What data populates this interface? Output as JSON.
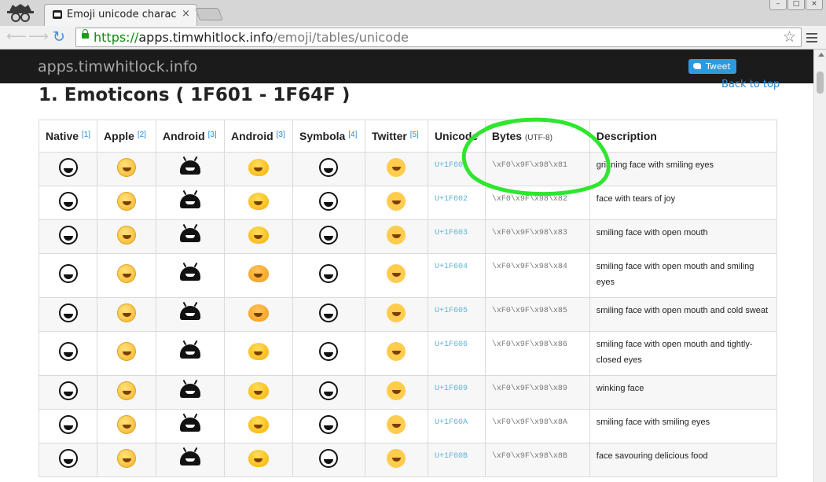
{
  "browser": {
    "tab_title": "Emoji unicode charac",
    "tab_close": "×",
    "url_scheme": "https://",
    "url_host": "apps.timwhitlock.info",
    "url_path": "/emoji/tables/unicode",
    "window_minimize": "–",
    "window_maximize": "□",
    "window_close": "×"
  },
  "site": {
    "brand": "apps.timwhitlock.info",
    "tweet_label": "Tweet",
    "back_to_top": "Back to top",
    "heading": "1. Emoticons ( 1F601 - 1F64F )"
  },
  "table": {
    "headers": [
      {
        "label": "Native",
        "note": "[1]"
      },
      {
        "label": "Apple",
        "note": "[2]"
      },
      {
        "label": "Android",
        "note": "[3]"
      },
      {
        "label": "Android",
        "note": "[3]"
      },
      {
        "label": "Symbola",
        "note": "[4]"
      },
      {
        "label": "Twitter",
        "note": "[5]"
      },
      {
        "label": "Unicode",
        "note": ""
      },
      {
        "label": "Bytes",
        "note": "(UTF-8)"
      },
      {
        "label": "Description",
        "note": ""
      }
    ],
    "rows": [
      {
        "code": "U+1F601",
        "bytes": "\\xF0\\x9F\\x98\\x81",
        "desc": "grinning face with smiling eyes"
      },
      {
        "code": "U+1F602",
        "bytes": "\\xF0\\x9F\\x98\\x82",
        "desc": "face with tears of joy"
      },
      {
        "code": "U+1F603",
        "bytes": "\\xF0\\x9F\\x98\\x83",
        "desc": "smiling face with open mouth"
      },
      {
        "code": "U+1F604",
        "bytes": "\\xF0\\x9F\\x98\\x84",
        "desc": "smiling face with open mouth and smiling eyes"
      },
      {
        "code": "U+1F605",
        "bytes": "\\xF0\\x9F\\x98\\x85",
        "desc": "smiling face with open mouth and cold sweat"
      },
      {
        "code": "U+1F606",
        "bytes": "\\xF0\\x9F\\x98\\x86",
        "desc": "smiling face with open mouth and tightly-closed eyes"
      },
      {
        "code": "U+1F609",
        "bytes": "\\xF0\\x9F\\x98\\x89",
        "desc": "winking face"
      },
      {
        "code": "U+1F60A",
        "bytes": "\\xF0\\x9F\\x98\\x8A",
        "desc": "smiling face with smiling eyes"
      },
      {
        "code": "U+1F60B",
        "bytes": "\\xF0\\x9F\\x98\\x8B",
        "desc": "face savouring delicious food"
      }
    ]
  },
  "colors": {
    "annotation": "#2ee62e",
    "link": "#2d8bd6",
    "site_bar": "#1b1b1b",
    "tweet": "#2b9ae0"
  }
}
